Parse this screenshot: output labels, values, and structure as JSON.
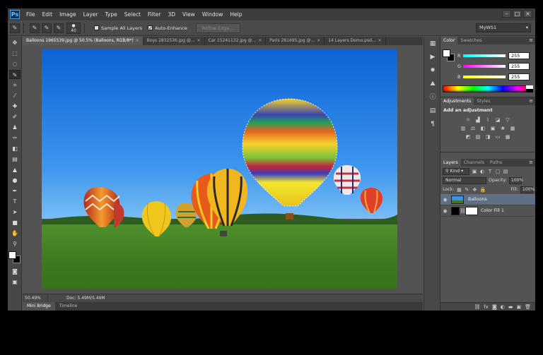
{
  "app": {
    "logo": "Ps"
  },
  "menu": [
    "File",
    "Edit",
    "Image",
    "Layer",
    "Type",
    "Select",
    "Filter",
    "3D",
    "View",
    "Window",
    "Help"
  ],
  "window_controls": [
    "–",
    "□",
    "×"
  ],
  "options": {
    "brush_size": "40",
    "sample_all_layers": "Sample All Layers",
    "auto_enhance": "Auto-Enhance",
    "refine_edge": "Refine Edge...",
    "workspace": "MyWS1"
  },
  "doc_tabs": [
    {
      "label": "Balloons 1965539.jpg @ 50.5% (Balloons, RGB/8*)",
      "active": true
    },
    {
      "label": "Boys 2832536.jpg @...",
      "active": false
    },
    {
      "label": "Car 15241132.jpg @...",
      "active": false
    },
    {
      "label": "Paris 281695.jpg @...",
      "active": false
    },
    {
      "label": "14 Layers Demo.psd...",
      "active": false
    }
  ],
  "status": {
    "zoom": "50.49%",
    "doc": "Doc: 5.49M/5.49M"
  },
  "bottom_tabs": [
    "Mini Bridge",
    "Timeline"
  ],
  "color_panel": {
    "tabs": [
      "Color",
      "Swatches"
    ],
    "channels": [
      {
        "label": "R",
        "value": "255"
      },
      {
        "label": "G",
        "value": "255"
      },
      {
        "label": "B",
        "value": "255"
      }
    ]
  },
  "adjustments_panel": {
    "tabs": [
      "Adjustments",
      "Styles"
    ],
    "title": "Add an adjustment"
  },
  "layers_panel": {
    "tabs": [
      "Layers",
      "Channels",
      "Paths"
    ],
    "filter": "Kind",
    "blend_mode": "Normal",
    "opacity_label": "Opacity:",
    "opacity": "100%",
    "lock_label": "Lock:",
    "fill_label": "Fill:",
    "fill": "100%",
    "layers": [
      {
        "name": "Balloons",
        "selected": true
      },
      {
        "name": "Color Fill 1",
        "selected": false
      }
    ]
  }
}
